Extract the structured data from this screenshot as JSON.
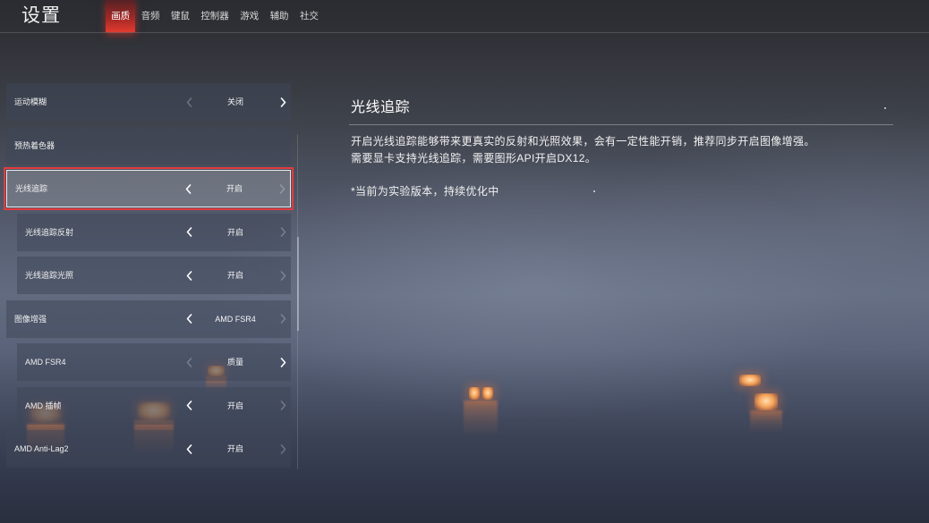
{
  "header": {
    "title": "设置"
  },
  "tabs": [
    {
      "label": "画质",
      "active": true
    },
    {
      "label": "音频",
      "active": false
    },
    {
      "label": "键鼠",
      "active": false
    },
    {
      "label": "控制器",
      "active": false
    },
    {
      "label": "游戏",
      "active": false
    },
    {
      "label": "辅助",
      "active": false
    },
    {
      "label": "社交",
      "active": false
    }
  ],
  "settings": {
    "rows": [
      {
        "label": "运动模糊",
        "value": "关闭",
        "sub": false,
        "selected": false,
        "prev_enabled": false,
        "next_enabled": true
      },
      {
        "label": "预热着色器",
        "sub": false,
        "selected": false
      },
      {
        "label": "光线追踪",
        "value": "开启",
        "sub": false,
        "selected": true,
        "prev_enabled": true,
        "next_enabled": false
      },
      {
        "label": "光线追踪反射",
        "value": "开启",
        "sub": true,
        "selected": false,
        "prev_enabled": true,
        "next_enabled": false
      },
      {
        "label": "光线追踪光照",
        "value": "开启",
        "sub": true,
        "selected": false,
        "prev_enabled": true,
        "next_enabled": false
      },
      {
        "label": "图像增强",
        "value": "AMD FSR4",
        "sub": false,
        "selected": false,
        "prev_enabled": true,
        "next_enabled": false
      },
      {
        "label": "AMD FSR4",
        "value": "质量",
        "sub": true,
        "selected": false,
        "prev_enabled": false,
        "next_enabled": true
      },
      {
        "label": "AMD 插帧",
        "value": "开启",
        "sub": true,
        "selected": false,
        "prev_enabled": true,
        "next_enabled": false
      },
      {
        "label": "AMD Anti-Lag2",
        "value": "开启",
        "sub": false,
        "selected": false,
        "prev_enabled": true,
        "next_enabled": false
      }
    ]
  },
  "detail": {
    "title": "光线追踪",
    "description": [
      "开启光线追踪能够带来更真实的反射和光照效果，会有一定性能开销，推荐同步开启图像增强。",
      "需要显卡支持光线追踪，需要图形API开启DX12。"
    ],
    "note": "*当前为实验版本，持续优化中"
  },
  "icons": {
    "prev_option": "chevron-left-icon",
    "next_option": "chevron-right-icon"
  },
  "colors": {
    "active_tab": "#d8342d",
    "selection_outline": "#e33b3e",
    "lantern": "#f6a35a"
  }
}
